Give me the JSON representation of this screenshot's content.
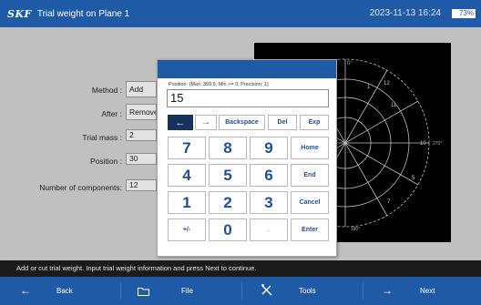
{
  "header": {
    "brand": "SKF",
    "title": "Trial weight on Plane 1",
    "datetime": "2023-11-13 16:24",
    "battery": "73%"
  },
  "form": {
    "method_label": "Method :",
    "method_value": "Add",
    "after_label": "After :",
    "after_value": "Remove",
    "trial_mass_label": "Trial mass :",
    "trial_mass_value": "2",
    "position_label": "Position :",
    "position_value": "30",
    "components_label": "Number of components:",
    "components_value": "12"
  },
  "polar": {
    "ticks": [
      "0°",
      "11",
      "12",
      "1",
      "10",
      "270°",
      "5",
      "7",
      "180°"
    ]
  },
  "keypad": {
    "hint": "Position: (Max: 359.9, Min >= 0, Precision: 1)",
    "value": "15",
    "keys": {
      "left": "←",
      "right": "→",
      "backspace": "Backspace",
      "del": "Del",
      "exp": "Exp",
      "k7": "7",
      "k8": "8",
      "k9": "9",
      "home": "Home",
      "k4": "4",
      "k5": "5",
      "k6": "6",
      "end": "End",
      "k1": "1",
      "k2": "2",
      "k3": "3",
      "cancel": "Cancel",
      "plusminus": "+/-",
      "k0": "0",
      "dot": ".",
      "enter": "Enter"
    }
  },
  "status": {
    "text": "Add or cut trial weight. Input trial weight information and press Next to continue."
  },
  "bottom": {
    "back": "Back",
    "file": "File",
    "tools": "Tools",
    "next": "Next"
  }
}
